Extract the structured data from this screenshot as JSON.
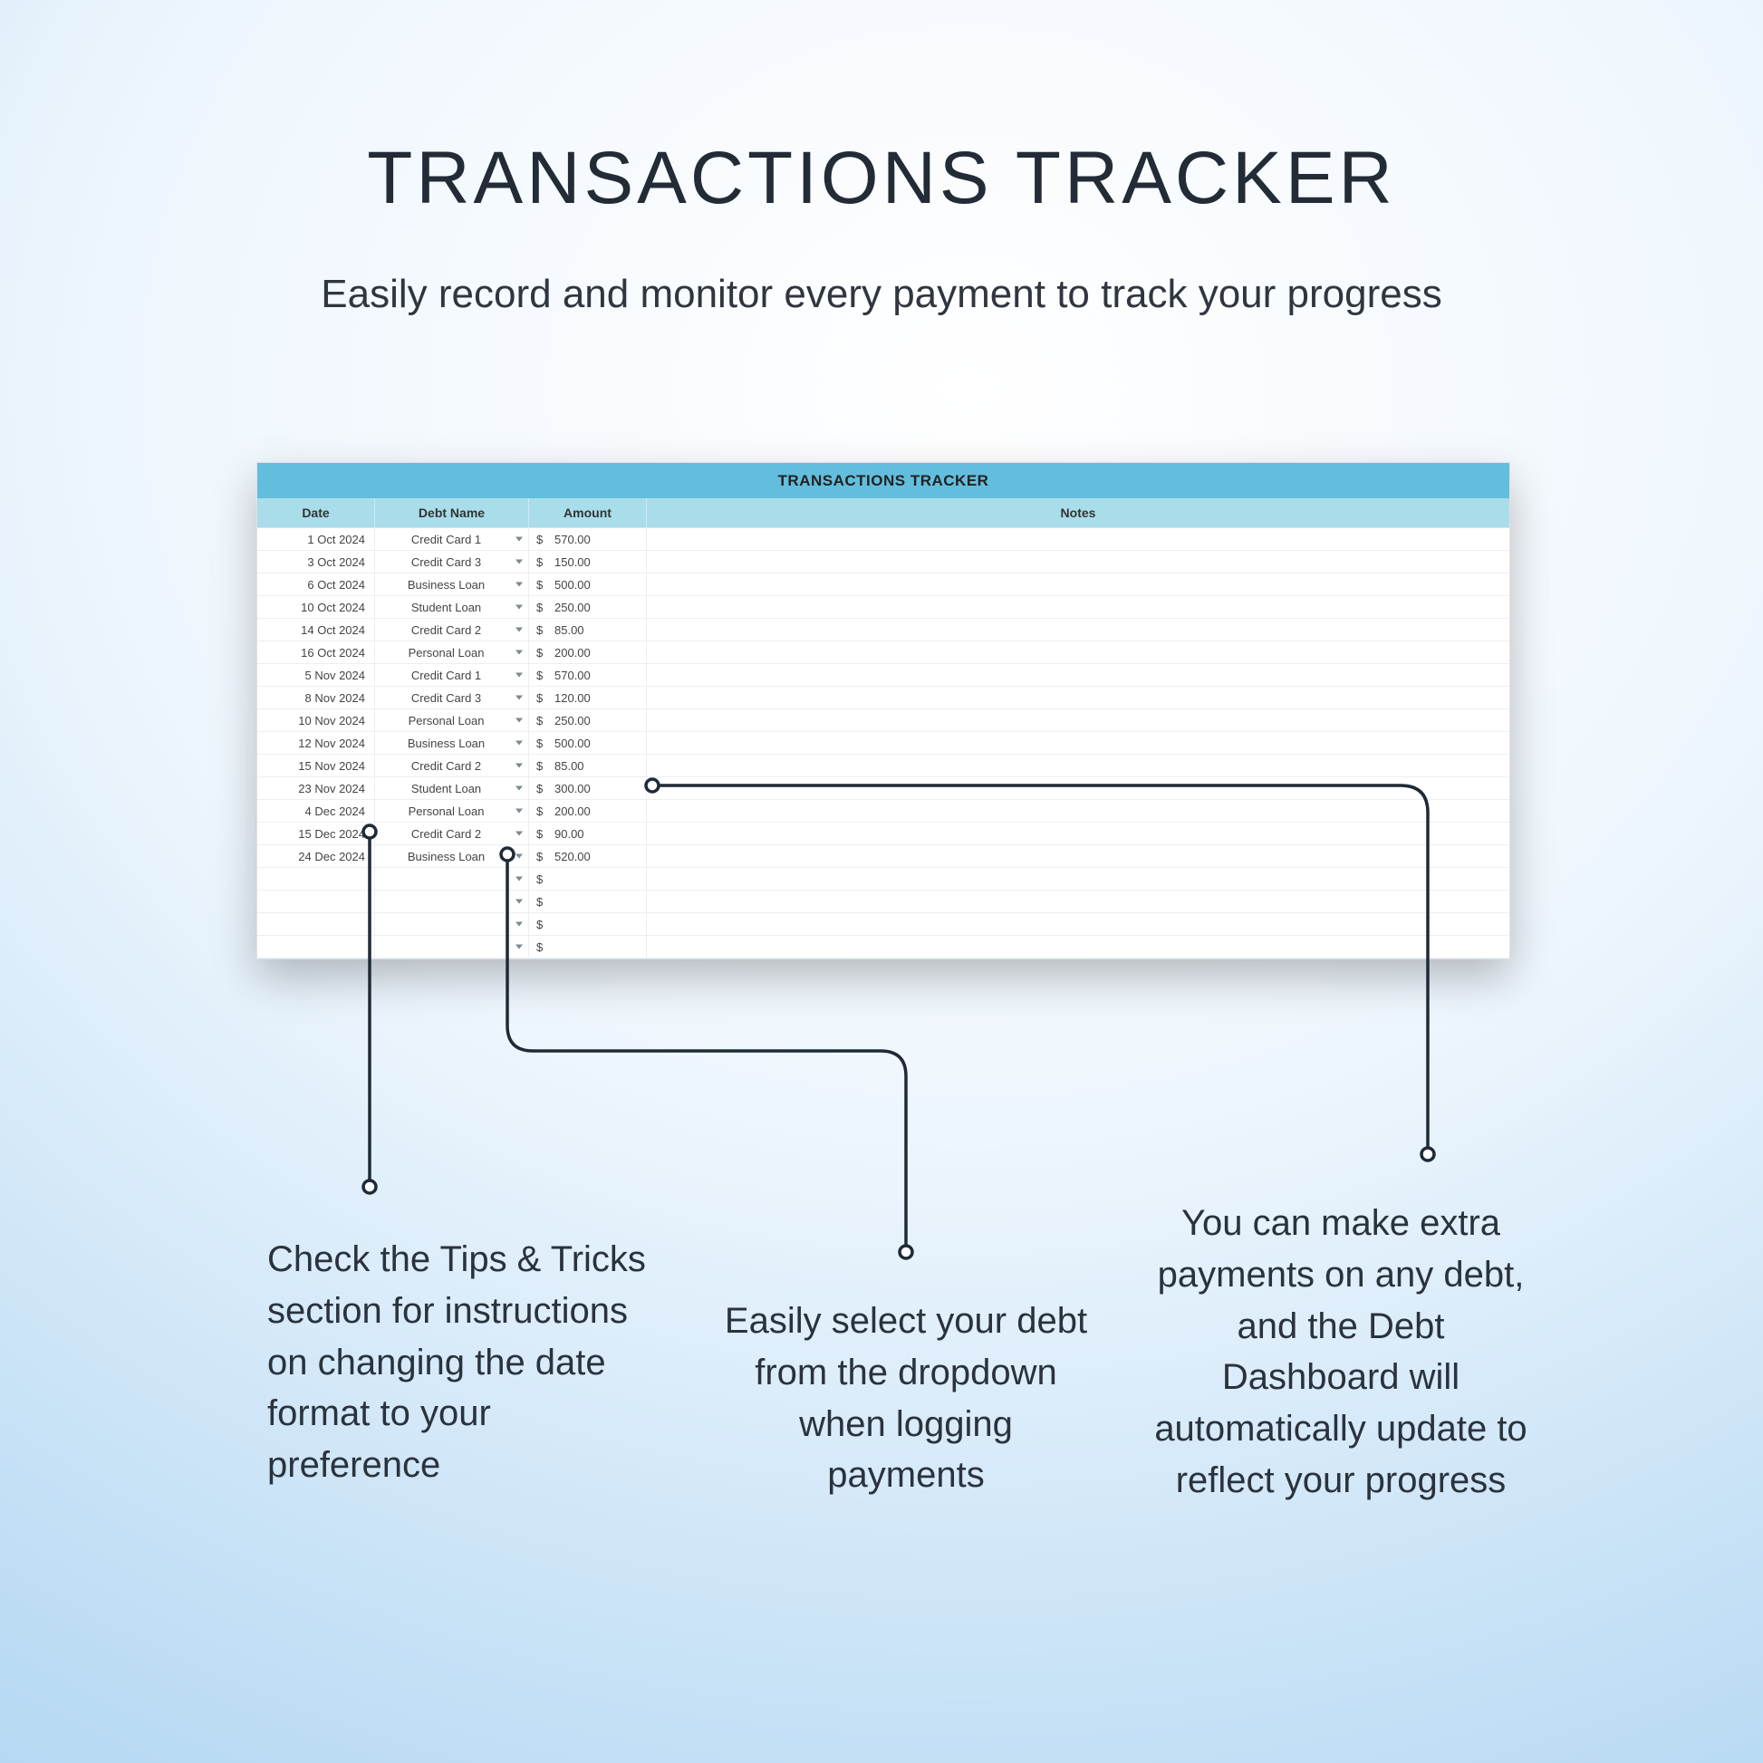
{
  "title": "TRANSACTIONS TRACKER",
  "subtitle": "Easily record and monitor every payment to track your progress",
  "sheet": {
    "banner": "TRANSACTIONS TRACKER",
    "headers": {
      "date": "Date",
      "debt": "Debt Name",
      "amount": "Amount",
      "notes": "Notes"
    },
    "currency": "$",
    "rows": [
      {
        "date": "1 Oct 2024",
        "debt": "Credit Card 1",
        "amount": "570.00"
      },
      {
        "date": "3 Oct 2024",
        "debt": "Credit Card 3",
        "amount": "150.00"
      },
      {
        "date": "6 Oct 2024",
        "debt": "Business Loan",
        "amount": "500.00"
      },
      {
        "date": "10 Oct 2024",
        "debt": "Student Loan",
        "amount": "250.00"
      },
      {
        "date": "14 Oct 2024",
        "debt": "Credit Card 2",
        "amount": "85.00"
      },
      {
        "date": "16 Oct 2024",
        "debt": "Personal Loan",
        "amount": "200.00"
      },
      {
        "date": "5 Nov 2024",
        "debt": "Credit Card 1",
        "amount": "570.00"
      },
      {
        "date": "8 Nov 2024",
        "debt": "Credit Card 3",
        "amount": "120.00"
      },
      {
        "date": "10 Nov 2024",
        "debt": "Personal Loan",
        "amount": "250.00"
      },
      {
        "date": "12 Nov 2024",
        "debt": "Business Loan",
        "amount": "500.00"
      },
      {
        "date": "15 Nov 2024",
        "debt": "Credit Card 2",
        "amount": "85.00"
      },
      {
        "date": "23 Nov 2024",
        "debt": "Student Loan",
        "amount": "300.00"
      },
      {
        "date": "4 Dec 2024",
        "debt": "Personal Loan",
        "amount": "200.00"
      },
      {
        "date": "15 Dec 2024",
        "debt": "Credit Card 2",
        "amount": "90.00"
      },
      {
        "date": "24 Dec 2024",
        "debt": "Business Loan",
        "amount": "520.00"
      },
      {
        "date": "",
        "debt": "",
        "amount": ""
      },
      {
        "date": "",
        "debt": "",
        "amount": ""
      },
      {
        "date": "",
        "debt": "",
        "amount": ""
      },
      {
        "date": "",
        "debt": "",
        "amount": ""
      }
    ]
  },
  "callouts": {
    "left": "Check the Tips & Tricks section for instructions on changing the date format to your preference",
    "center": "Easily select your debt from the dropdown when logging payments",
    "right": "You can make extra payments on any debt, and the Debt Dashboard will automatically update to reflect your progress"
  }
}
